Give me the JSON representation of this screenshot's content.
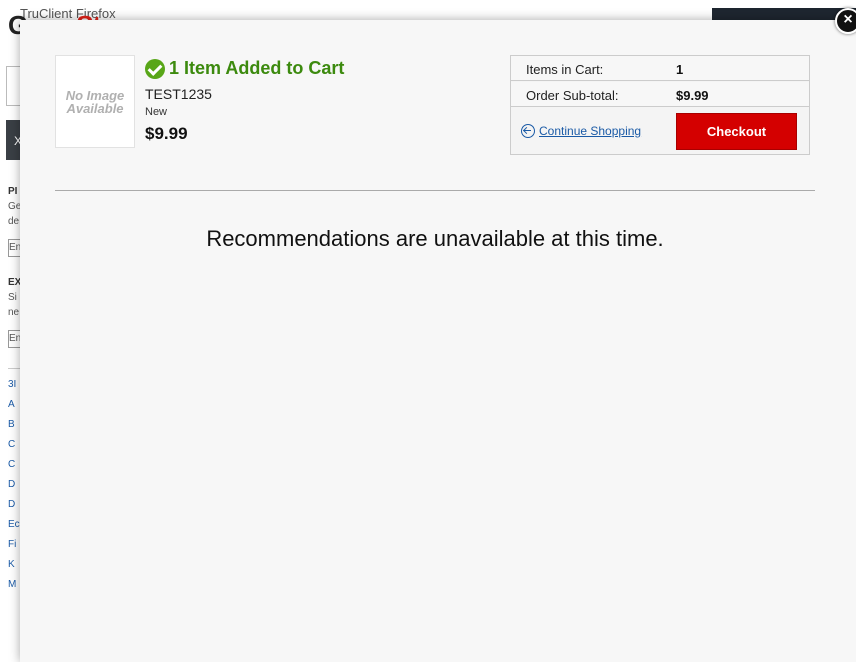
{
  "background": {
    "window_title": "TruClient Firefox",
    "logo_part1": "Game",
    "logo_part2": "Stop",
    "nav_fragment": "X",
    "side_heading_1": "PI",
    "side_text_1": "Ge",
    "side_text_2": "de",
    "side_input_1": "En",
    "side_heading_2": "EX",
    "side_text_3": "Si",
    "side_text_4": "ne",
    "side_input_2": "En",
    "side_links": [
      "3I",
      "A",
      "B",
      "C",
      "C",
      "D",
      "D",
      "Ec",
      "Fi",
      "K",
      "M"
    ]
  },
  "modal": {
    "image_placeholder": "No Image Available",
    "added_message": "1 Item Added to Cart",
    "product_sku": "TEST1235",
    "product_condition": "New",
    "product_price": "$9.99",
    "summary": {
      "items_label": "Items in Cart:",
      "items_value": "1",
      "subtotal_label": "Order Sub-total:",
      "subtotal_value": "$9.99",
      "continue_label": "Continue Shopping",
      "checkout_label": "Checkout"
    },
    "recommendations_text": "Recommendations are unavailable at this time.",
    "close_symbol": "×"
  },
  "colors": {
    "accent_green": "#58a618",
    "checkout_red": "#d40000",
    "link_blue": "#1a5aa6"
  }
}
